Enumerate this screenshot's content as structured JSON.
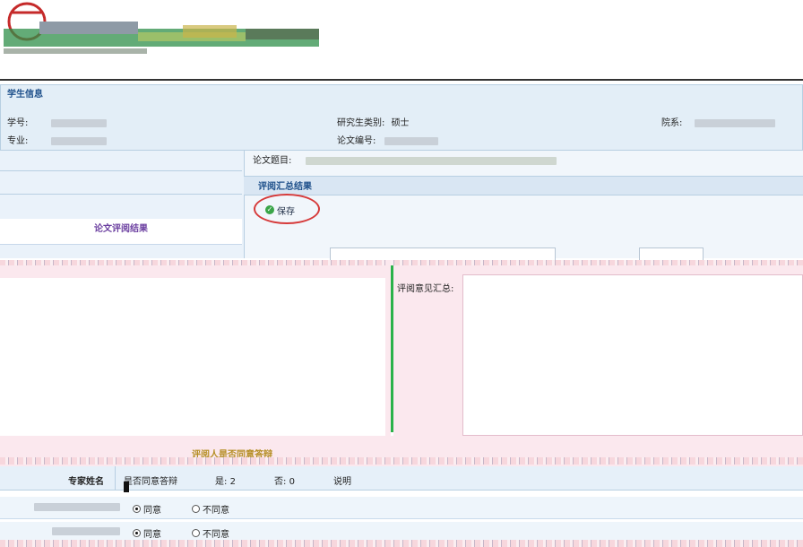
{
  "student_panel": {
    "title": "学生信息",
    "id_label": "学号:",
    "type_label": "研究生类别:",
    "type_value": "硕士",
    "dept_label": "院系:",
    "major_label": "专业:",
    "thesis_no_label": "论文编号:"
  },
  "thesis": {
    "title_label": "论文题目:"
  },
  "summary": {
    "title": "评阅汇总结果",
    "save_label": "保存",
    "left_title": "论文评阅结果",
    "opinion_label": "评阅意见汇总:"
  },
  "agree": {
    "title": "评阅人是否同意答辩",
    "expert_header": "专家姓名",
    "agree_header": "是否同意答辩",
    "yes_count_label": "是:",
    "yes_count_value": "2",
    "no_count_label": "否:",
    "no_count_value": "0",
    "explain_header": "说明",
    "rows": [
      {
        "agree": "同意",
        "disagree": "不同意",
        "selected": "agree"
      },
      {
        "agree": "同意",
        "disagree": "不同意",
        "selected": "agree"
      }
    ]
  },
  "colors": {
    "accent": "#1d4f8a",
    "pink": "#fbe8ee",
    "green": "#2bb24a",
    "highlight_circle": "#d63a3a"
  },
  "icons": {
    "save": "check-circle-icon"
  }
}
